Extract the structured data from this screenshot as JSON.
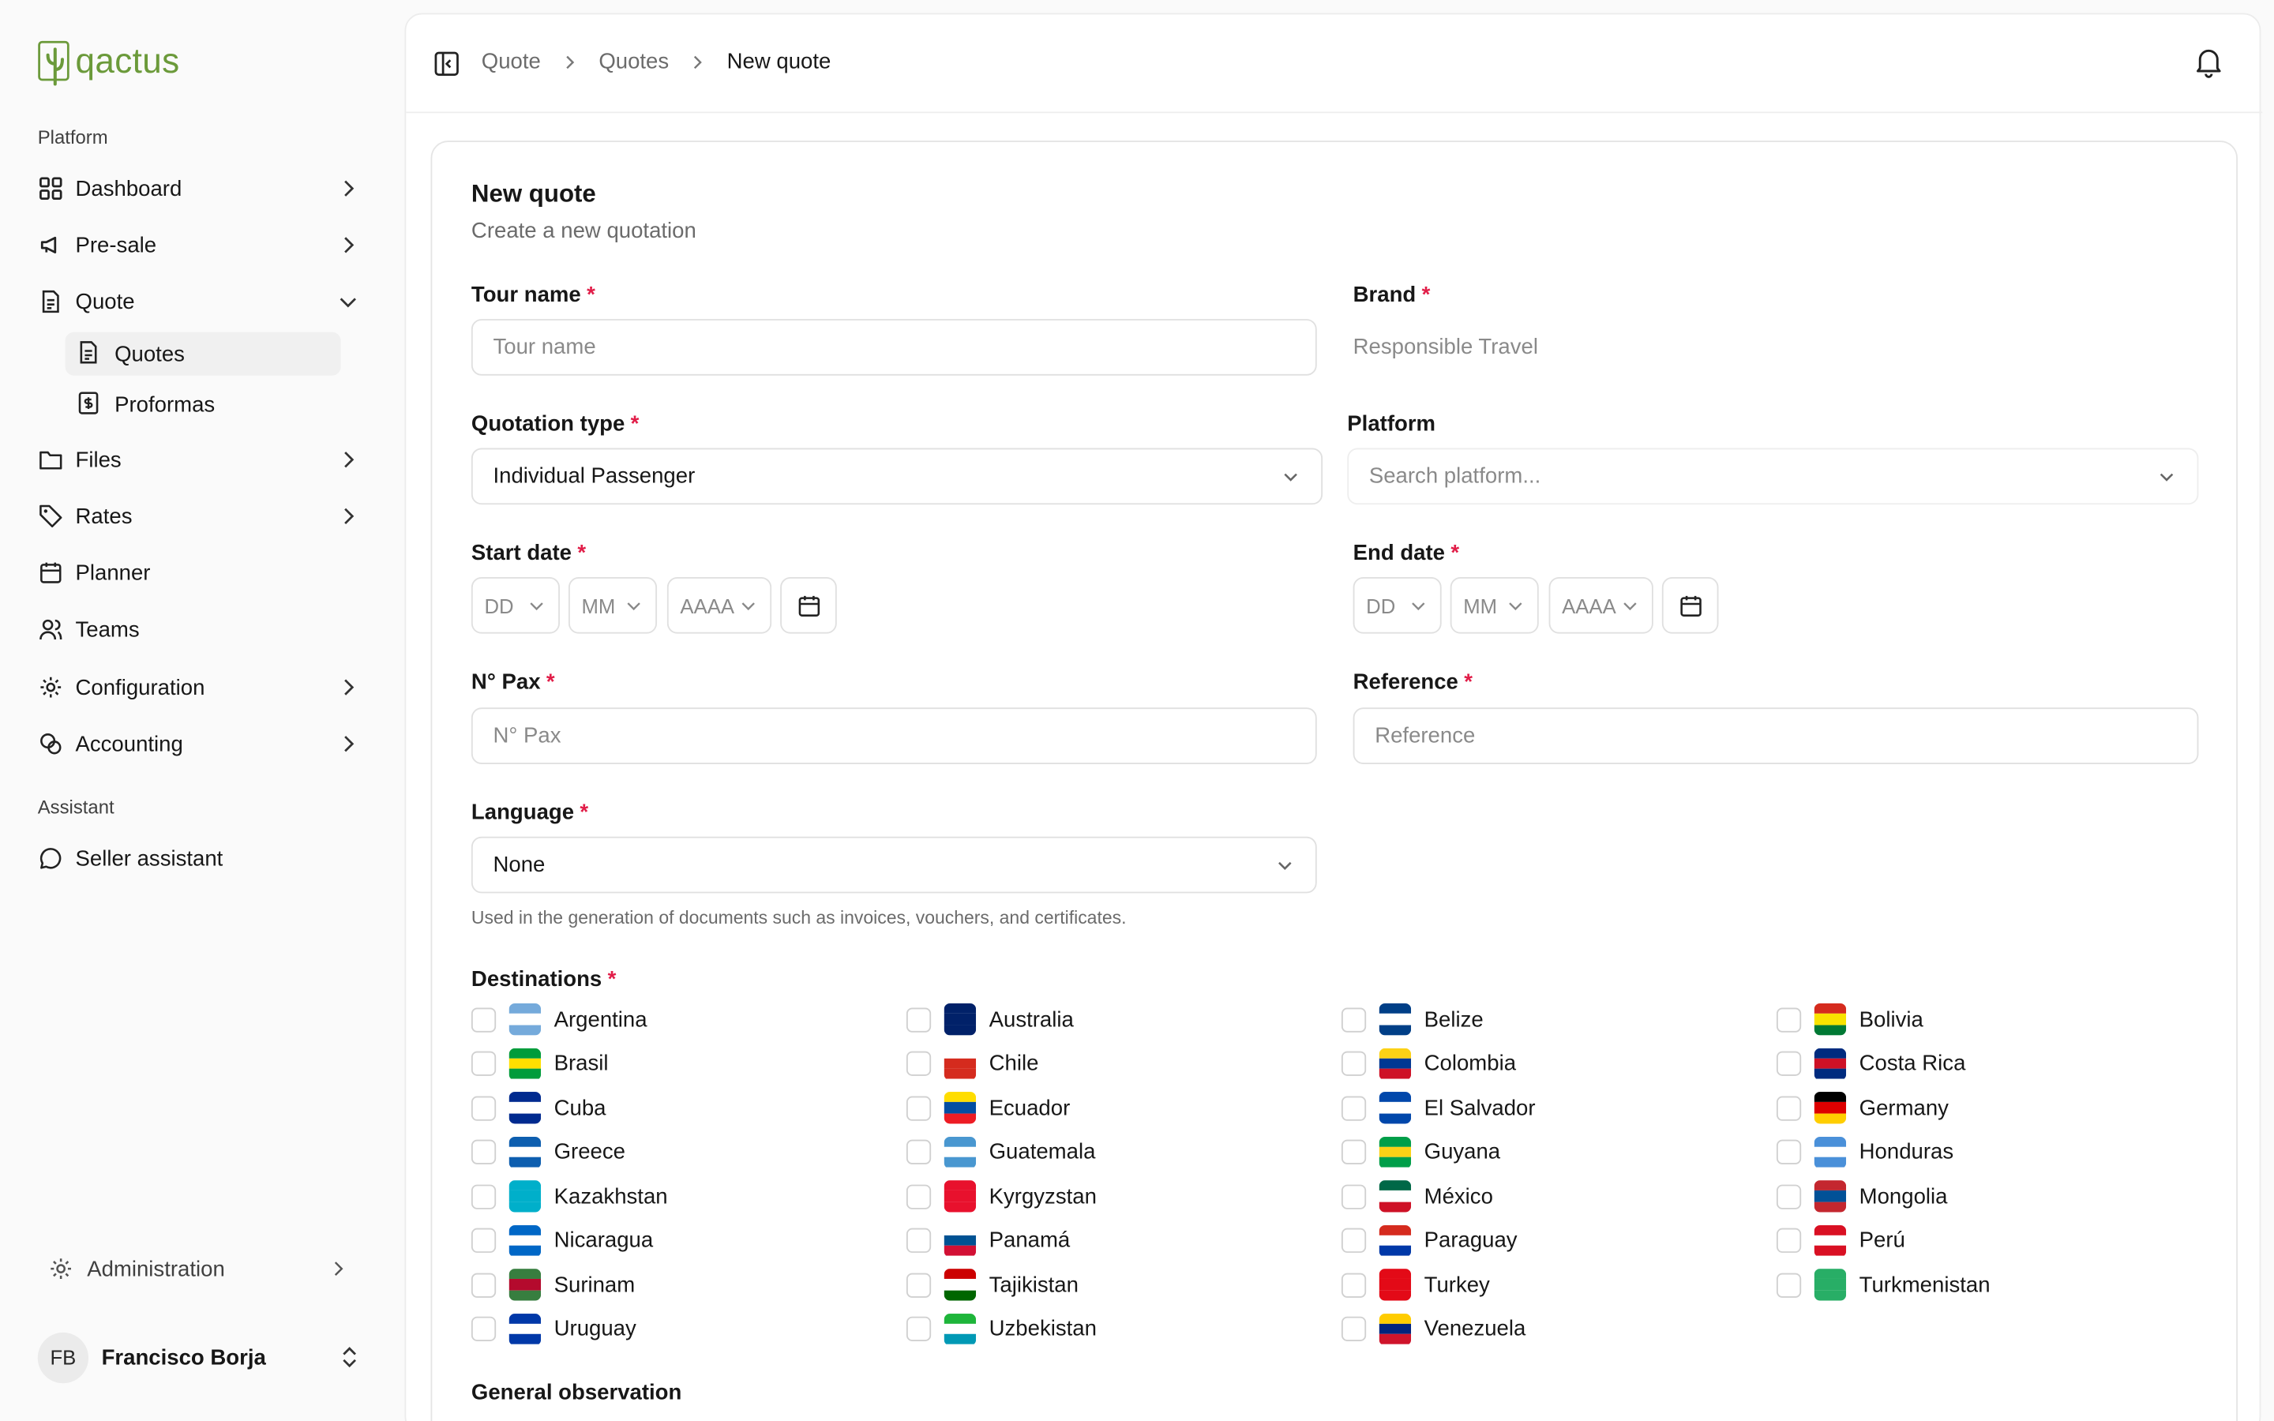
{
  "app": {
    "logo_text": "qactus"
  },
  "sidebar": {
    "platform_label": "Platform",
    "items": [
      {
        "label": "Dashboard",
        "icon": "grid-icon"
      },
      {
        "label": "Pre-sale",
        "icon": "megaphone-icon"
      },
      {
        "label": "Quote",
        "icon": "document-icon"
      },
      {
        "label": "Files",
        "icon": "folder-icon"
      },
      {
        "label": "Rates",
        "icon": "tag-icon"
      },
      {
        "label": "Planner",
        "icon": "calendar-icon"
      },
      {
        "label": "Teams",
        "icon": "users-icon"
      },
      {
        "label": "Configuration",
        "icon": "gear-icon"
      },
      {
        "label": "Accounting",
        "icon": "coins-icon"
      }
    ],
    "quote_sub": [
      {
        "label": "Quotes"
      },
      {
        "label": "Proformas"
      }
    ],
    "assistant_label": "Assistant",
    "assistant_item": "Seller assistant",
    "admin": "Administration",
    "user": {
      "initials": "FB",
      "name": "Francisco Borja"
    }
  },
  "breadcrumb": [
    "Quote",
    "Quotes",
    "New quote"
  ],
  "form": {
    "title": "New quote",
    "subtitle": "Create a new quotation",
    "tour_name": {
      "label": "Tour name",
      "placeholder": "Tour name"
    },
    "brand": {
      "label": "Brand",
      "value": "Responsible Travel"
    },
    "quotation_type": {
      "label": "Quotation type",
      "value": "Individual Passenger"
    },
    "platform": {
      "label": "Platform",
      "placeholder": "Search platform..."
    },
    "start_date": {
      "label": "Start date",
      "dd": "DD",
      "mm": "MM",
      "yyyy": "AAAA"
    },
    "end_date": {
      "label": "End date",
      "dd": "DD",
      "mm": "MM",
      "yyyy": "AAAA"
    },
    "pax": {
      "label": "N° Pax",
      "placeholder": "N° Pax"
    },
    "reference": {
      "label": "Reference",
      "placeholder": "Reference"
    },
    "language": {
      "label": "Language",
      "value": "None",
      "hint": "Used in the generation of documents such as invoices, vouchers, and certificates."
    },
    "destinations_label": "Destinations",
    "destinations": [
      {
        "name": "Argentina",
        "colors": [
          "#75aadb",
          "#ffffff",
          "#75aadb"
        ]
      },
      {
        "name": "Australia",
        "colors": [
          "#012169",
          "#012169",
          "#012169"
        ]
      },
      {
        "name": "Belize",
        "colors": [
          "#003f87",
          "#ffffff",
          "#003f87"
        ]
      },
      {
        "name": "Bolivia",
        "colors": [
          "#d52b1e",
          "#f9e300",
          "#007934"
        ]
      },
      {
        "name": "Brasil",
        "colors": [
          "#009c3b",
          "#ffdf00",
          "#009c3b"
        ]
      },
      {
        "name": "Chile",
        "colors": [
          "#ffffff",
          "#d52b1e",
          "#d52b1e"
        ]
      },
      {
        "name": "Colombia",
        "colors": [
          "#fcd116",
          "#003893",
          "#ce1126"
        ]
      },
      {
        "name": "Costa Rica",
        "colors": [
          "#002b7f",
          "#ce1126",
          "#002b7f"
        ]
      },
      {
        "name": "Cuba",
        "colors": [
          "#002a8f",
          "#ffffff",
          "#002a8f"
        ]
      },
      {
        "name": "Ecuador",
        "colors": [
          "#ffdd00",
          "#034ea2",
          "#ed1c24"
        ]
      },
      {
        "name": "El Salvador",
        "colors": [
          "#0047ab",
          "#ffffff",
          "#0047ab"
        ]
      },
      {
        "name": "Germany",
        "colors": [
          "#000000",
          "#dd0000",
          "#ffce00"
        ]
      },
      {
        "name": "Greece",
        "colors": [
          "#0d5eaf",
          "#ffffff",
          "#0d5eaf"
        ]
      },
      {
        "name": "Guatemala",
        "colors": [
          "#4997d0",
          "#ffffff",
          "#4997d0"
        ]
      },
      {
        "name": "Guyana",
        "colors": [
          "#009e49",
          "#fcd116",
          "#009e49"
        ]
      },
      {
        "name": "Honduras",
        "colors": [
          "#4a90d9",
          "#ffffff",
          "#4a90d9"
        ]
      },
      {
        "name": "Kazakhstan",
        "colors": [
          "#00afca",
          "#00afca",
          "#00afca"
        ]
      },
      {
        "name": "Kyrgyzstan",
        "colors": [
          "#e8112d",
          "#e8112d",
          "#e8112d"
        ]
      },
      {
        "name": "México",
        "colors": [
          "#006847",
          "#ffffff",
          "#ce1126"
        ]
      },
      {
        "name": "Mongolia",
        "colors": [
          "#c4272f",
          "#015197",
          "#c4272f"
        ]
      },
      {
        "name": "Nicaragua",
        "colors": [
          "#0067c6",
          "#ffffff",
          "#0067c6"
        ]
      },
      {
        "name": "Panamá",
        "colors": [
          "#ffffff",
          "#005293",
          "#d21034"
        ]
      },
      {
        "name": "Paraguay",
        "colors": [
          "#d52b1e",
          "#ffffff",
          "#0038a8"
        ]
      },
      {
        "name": "Perú",
        "colors": [
          "#d91023",
          "#ffffff",
          "#d91023"
        ]
      },
      {
        "name": "Surinam",
        "colors": [
          "#377e3f",
          "#b40a2d",
          "#377e3f"
        ]
      },
      {
        "name": "Tajikistan",
        "colors": [
          "#cc0000",
          "#ffffff",
          "#006600"
        ]
      },
      {
        "name": "Turkey",
        "colors": [
          "#e30a17",
          "#e30a17",
          "#e30a17"
        ]
      },
      {
        "name": "Turkmenistan",
        "colors": [
          "#28ae66",
          "#28ae66",
          "#28ae66"
        ]
      },
      {
        "name": "Uruguay",
        "colors": [
          "#0038a8",
          "#ffffff",
          "#0038a8"
        ]
      },
      {
        "name": "Uzbekistan",
        "colors": [
          "#1eb53a",
          "#ffffff",
          "#0099b5"
        ]
      },
      {
        "name": "Venezuela",
        "colors": [
          "#ffcc00",
          "#00247d",
          "#cf142b"
        ]
      }
    ],
    "general_observation_label": "General observation"
  }
}
